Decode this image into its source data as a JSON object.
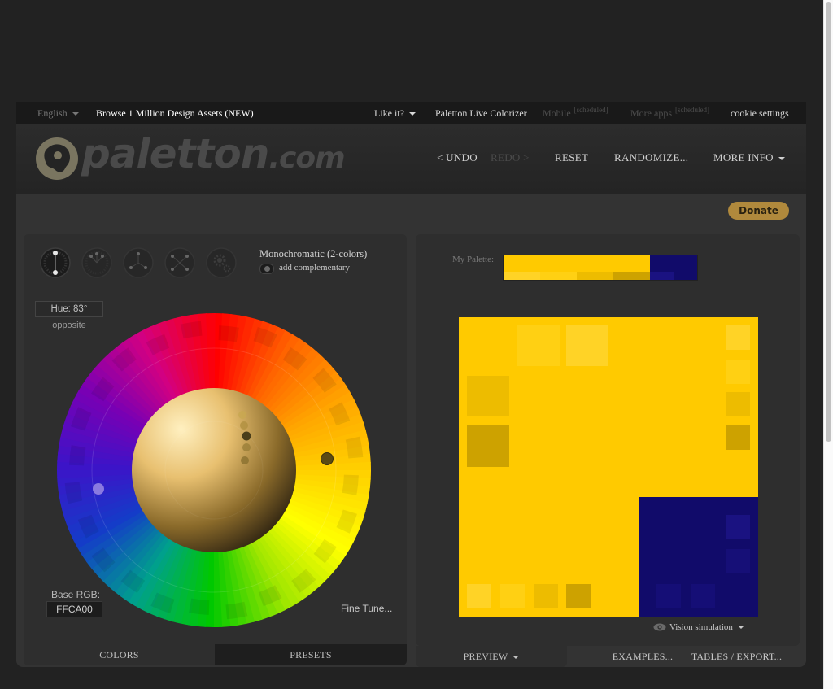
{
  "topbar": {
    "language": "English",
    "browse_assets": "Browse 1 Million Design Assets (NEW)",
    "like_it": "Like it?",
    "live_colorizer": "Paletton Live Colorizer",
    "mobile": "Mobile",
    "mobile_badge": "[scheduled]",
    "more_apps": "More apps",
    "more_apps_badge": "[scheduled]",
    "cookie_settings": "cookie settings"
  },
  "header": {
    "logo_main": "paletton",
    "logo_suffix": ".com",
    "undo": "< UNDO",
    "redo": "REDO >",
    "reset": "RESET",
    "randomize": "RANDOMIZE...",
    "more_info": "MORE INFO"
  },
  "donate_label": "Donate",
  "left": {
    "presets": [
      {
        "name": "mono"
      },
      {
        "name": "adjacent"
      },
      {
        "name": "triad"
      },
      {
        "name": "tetrad"
      },
      {
        "name": "free-style"
      }
    ],
    "scheme_title": "Monochromatic (2-colors)",
    "add_complementary": "add complementary",
    "hue": "Hue: 83°",
    "hue_mode": "opposite",
    "base_rgb_label": "Base RGB:",
    "base_rgb_value": "FFCA00",
    "fine_tune": "Fine Tune...",
    "tabs": {
      "colors": "COLORS",
      "presets": "PRESETS"
    }
  },
  "right": {
    "my_palette_label": "My Palette:",
    "colors": {
      "primary": "#FFCA00",
      "primary_light1": "#FFD013",
      "primary_light2": "#FFD326",
      "primary_dark1": "#EDBC00",
      "primary_dark2": "#CDA200",
      "complement": "#110B6A",
      "complement_light": "#1A1281"
    },
    "vision_simulation": "Vision simulation",
    "tabs": {
      "preview": "PREVIEW",
      "examples": "EXAMPLES...",
      "tables_export": "TABLES / EXPORT..."
    }
  }
}
